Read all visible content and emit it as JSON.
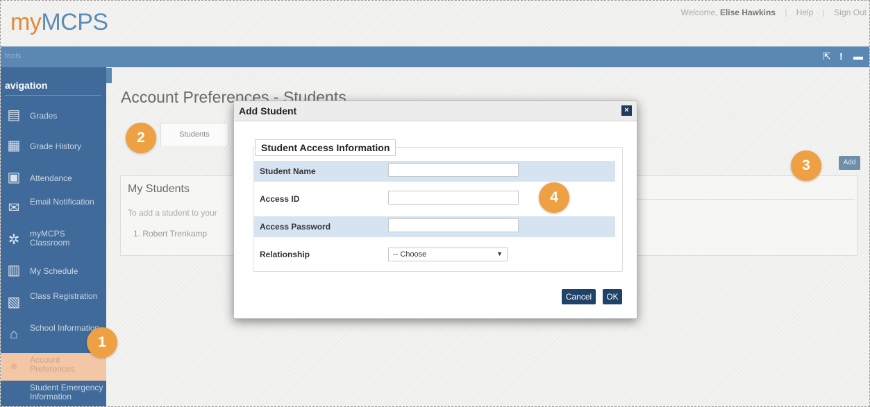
{
  "header": {
    "logo_my": "my",
    "logo_mcps": "MCPS",
    "welcome_prefix": "Welcome,",
    "user_name": "Elise Hawkins",
    "help": "Help",
    "sign_out": "Sign Out"
  },
  "toolbar": {
    "left_label": "tools"
  },
  "sidebar": {
    "title": "avigation",
    "items": [
      {
        "label": "Grades",
        "icon": "grades-icon"
      },
      {
        "label": "Grade History",
        "icon": "grade-history-icon"
      },
      {
        "label": "Attendance",
        "icon": "attendance-icon"
      },
      {
        "label": "Email Notification",
        "icon": "email-icon"
      },
      {
        "label": "myMCPS Classroom",
        "icon": "classroom-icon"
      },
      {
        "label": "My Schedule",
        "icon": "schedule-icon"
      },
      {
        "label": "Class Registration",
        "icon": "registration-icon"
      },
      {
        "label": "School Information",
        "icon": "school-icon"
      },
      {
        "label": "Account Preferences",
        "icon": "account-icon"
      },
      {
        "label": "Student Emergency Information",
        "icon": "emergency-icon"
      }
    ]
  },
  "page": {
    "title": "Account Preferences - Students",
    "tab_students": "Students",
    "my_students_heading": "My Students",
    "my_students_text": "To add a student to your",
    "student_1": "1. Robert Trenkamp",
    "add_button": "Add"
  },
  "modal": {
    "title": "Add Student",
    "close": "×",
    "legend": "Student Access Information",
    "fields": {
      "student_name": "Student Name",
      "access_id": "Access ID",
      "access_password": "Access Password",
      "relationship": "Relationship"
    },
    "relationship_selected": "-- Choose",
    "cancel": "Cancel",
    "ok": "OK"
  },
  "badges": [
    "1",
    "2",
    "3",
    "4"
  ],
  "colors": {
    "toolbar_blue": "#5b87b3",
    "sidebar_blue": "#3f6a99",
    "badge_orange": "#eea042",
    "button_navy": "#1f4368",
    "active_item": "#f3c6a6"
  }
}
